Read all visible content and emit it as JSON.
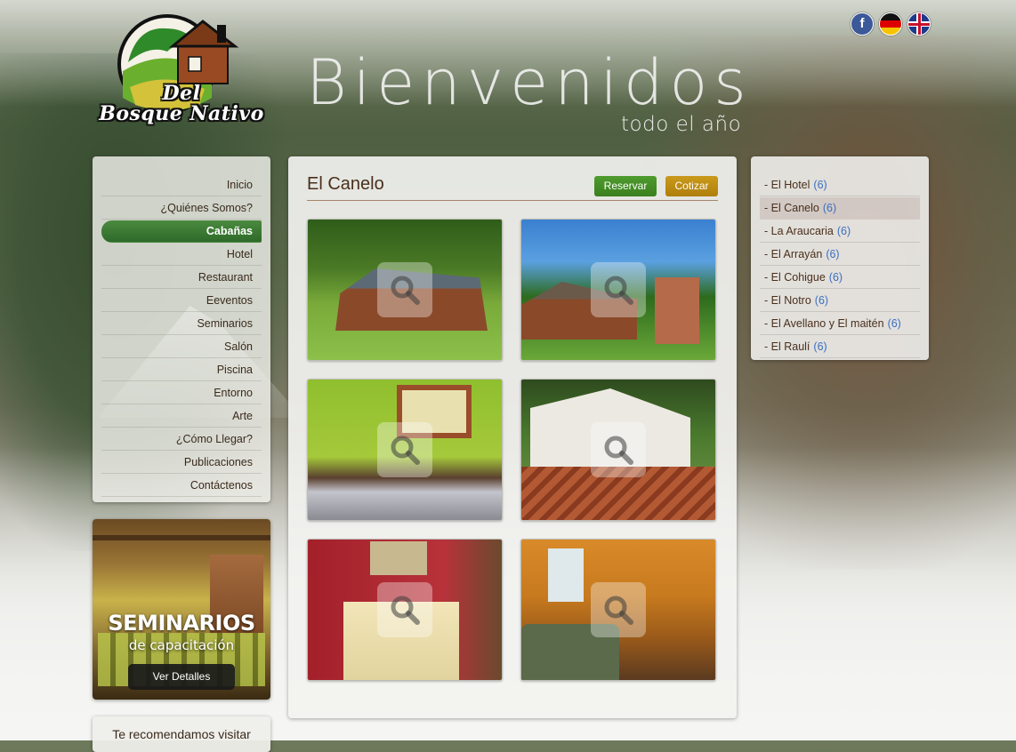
{
  "header": {
    "logo_line1": "Del",
    "logo_line2": "Bosque Nativo",
    "welcome": "Bienvenidos",
    "subwelcome": "todo el año"
  },
  "social": {
    "facebook_glyph": "f",
    "languages": [
      "German",
      "English"
    ]
  },
  "nav": {
    "items": [
      {
        "label": "Inicio",
        "active": false
      },
      {
        "label": "¿Quiénes Somos?",
        "active": false
      },
      {
        "label": "Cabañas",
        "active": true
      },
      {
        "label": "Hotel",
        "active": false
      },
      {
        "label": "Restaurant",
        "active": false
      },
      {
        "label": "Eeventos",
        "active": false
      },
      {
        "label": "Seminarios",
        "active": false
      },
      {
        "label": "Salón",
        "active": false
      },
      {
        "label": "Piscina",
        "active": false
      },
      {
        "label": "Entorno",
        "active": false
      },
      {
        "label": "Arte",
        "active": false
      },
      {
        "label": "¿Cómo Llegar?",
        "active": false
      },
      {
        "label": "Publicaciones",
        "active": false
      },
      {
        "label": "Contáctenos",
        "active": false
      }
    ]
  },
  "promo": {
    "title": "SEMINARIOS",
    "subtitle": "de capacitación",
    "button": "Ver Detalles"
  },
  "recommend": {
    "label": "Te recomendamos visitar"
  },
  "main": {
    "title": "El Canelo",
    "reservar": "Reservar",
    "cotizar": "Cotizar",
    "thumbnails": [
      {
        "subject": "cabin exterior with lawn"
      },
      {
        "subject": "cabin with barbecue grill"
      },
      {
        "subject": "bedroom with two beds"
      },
      {
        "subject": "cabin with wooden deck"
      },
      {
        "subject": "red bedroom with double bed"
      },
      {
        "subject": "living room with sofa"
      }
    ]
  },
  "categories": {
    "items": [
      {
        "label": "- El Hotel",
        "count": "(6)",
        "active": false
      },
      {
        "label": "- El Canelo",
        "count": "(6)",
        "active": true
      },
      {
        "label": "- La Araucaria",
        "count": "(6)",
        "active": false
      },
      {
        "label": "- El Arrayán",
        "count": "(6)",
        "active": false
      },
      {
        "label": "- El Cohigue",
        "count": "(6)",
        "active": false
      },
      {
        "label": "- El Notro",
        "count": "(6)",
        "active": false
      },
      {
        "label": "- El Avellano y El maitén",
        "count": "(6)",
        "active": false
      },
      {
        "label": "- El Raulí",
        "count": "(6)",
        "active": false
      }
    ]
  },
  "colors": {
    "active_nav": "#3a7a30",
    "reservar": "#3a7f1f",
    "cotizar": "#b07f0c",
    "count_blue": "#3a6fc4",
    "heading_brown": "#4a2f1c"
  }
}
